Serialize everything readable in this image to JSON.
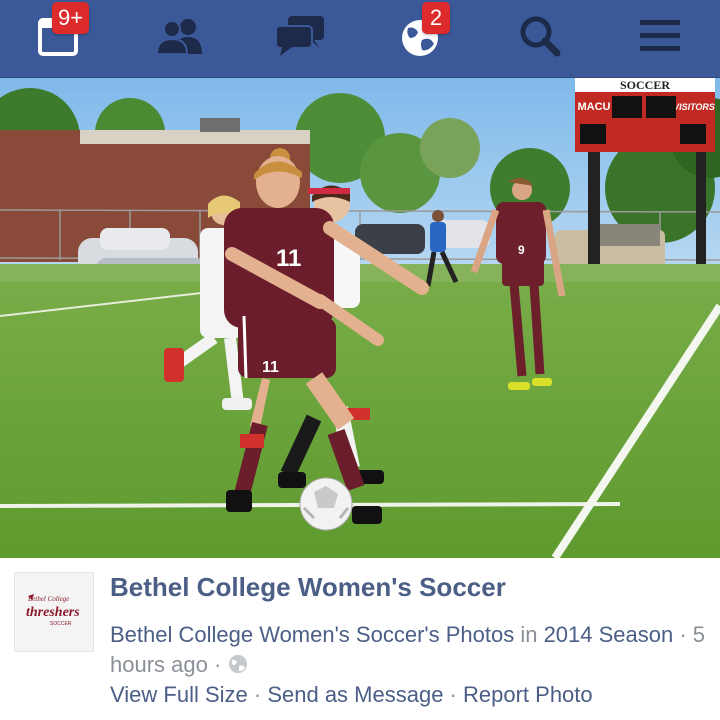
{
  "navbar": {
    "items": [
      {
        "name": "friend-requests",
        "badge": "9+"
      },
      {
        "name": "friends",
        "badge": ""
      },
      {
        "name": "messages",
        "badge": ""
      },
      {
        "name": "notifications",
        "badge": "2"
      },
      {
        "name": "search",
        "badge": ""
      },
      {
        "name": "menu",
        "badge": ""
      }
    ],
    "colors": {
      "bar": "#3b5998",
      "icon": "#1d2a49",
      "badge": "#dd2b2b"
    }
  },
  "photo": {
    "scoreboard": {
      "title": "SOCCER",
      "home": "MACU",
      "away": "VISITORS"
    },
    "jerseys": [
      "11",
      "9"
    ]
  },
  "post": {
    "page_name": "Bethel College Women's Soccer",
    "logo_text_top": "Bethel College",
    "logo_text_main": "threshers",
    "logo_text_bottom": "SOCCER",
    "album_prefix": "Bethel College Women's Soccer's Photos",
    "in_word": " in ",
    "album_name": "2014 Season",
    "time": " · 5 hours ago · ",
    "actions": {
      "view": "View Full Size",
      "send": "Send as Message",
      "report": "Report Photo",
      "separator": " · "
    }
  }
}
